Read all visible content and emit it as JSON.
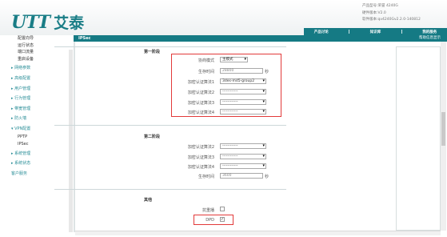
{
  "header": {
    "logo_mark": "UTT",
    "logo_cn": "艾泰",
    "product_info": [
      "产品型号:荣誉 4240G",
      "硬件版本:V2.0",
      "软件版本:qv4240Gv2.2.0-140812"
    ],
    "nav": [
      "产品讨论",
      "知识库",
      "我的服务"
    ]
  },
  "sidebar": {
    "items": [
      {
        "label": "配置向导",
        "type": "sub"
      },
      {
        "label": "运行状态",
        "type": "sub"
      },
      {
        "label": "端口流量",
        "type": "sub"
      },
      {
        "label": "重启设备",
        "type": "sub"
      },
      {
        "label": "▸ 网络参数",
        "type": "main"
      },
      {
        "label": "▸ 高级配置",
        "type": "main"
      },
      {
        "label": "▸ 用户管理",
        "type": "main"
      },
      {
        "label": "▸ 行为管理",
        "type": "main"
      },
      {
        "label": "▸ 带宽管理",
        "type": "main"
      },
      {
        "label": "▸ 防火墙",
        "type": "main"
      },
      {
        "label": "▾ VPN配置",
        "type": "main"
      },
      {
        "label": "PPTP",
        "type": "sub2"
      },
      {
        "label": "IPSec",
        "type": "sub2"
      },
      {
        "label": "▸ 系统管理",
        "type": "main"
      },
      {
        "label": "▸ 系统状态",
        "type": "main"
      },
      {
        "label": "客户服务",
        "type": "main"
      }
    ]
  },
  "page": {
    "title": "IPSec",
    "right_label": "帮助信息显示"
  },
  "phase1": {
    "title": "第一阶段",
    "negotiation_mode_label": "协商模式",
    "negotiation_mode_value": "主模式",
    "lifetime_label": "生存时间",
    "lifetime_value": "28800",
    "lifetime_unit": "秒",
    "alg1_label": "加密认证算法1",
    "alg1_value": "3des-md5-group2",
    "alg2_label": "加密认证算法2",
    "alg2_value": "------------",
    "alg3_label": "加密认证算法3",
    "alg3_value": "------------",
    "alg4_label": "加密认证算法4",
    "alg4_value": "------------"
  },
  "phase2": {
    "title": "第二阶段",
    "alg2_label": "加密认证算法2",
    "alg2_value": "------------",
    "alg3_label": "加密认证算法3",
    "alg3_value": "------------",
    "alg4_label": "加密认证算法4",
    "alg4_value": "------------",
    "lifetime_label": "生存时间",
    "lifetime_value": "3600",
    "lifetime_unit": "秒"
  },
  "other": {
    "title": "其他",
    "antireplay_label": "抗重播",
    "antireplay_checked": false,
    "dpd_label": "DPD",
    "dpd_checked": true,
    "check_mark": "✓"
  },
  "colors": {
    "brand": "#157a84",
    "highlight": "#e23a3a"
  }
}
